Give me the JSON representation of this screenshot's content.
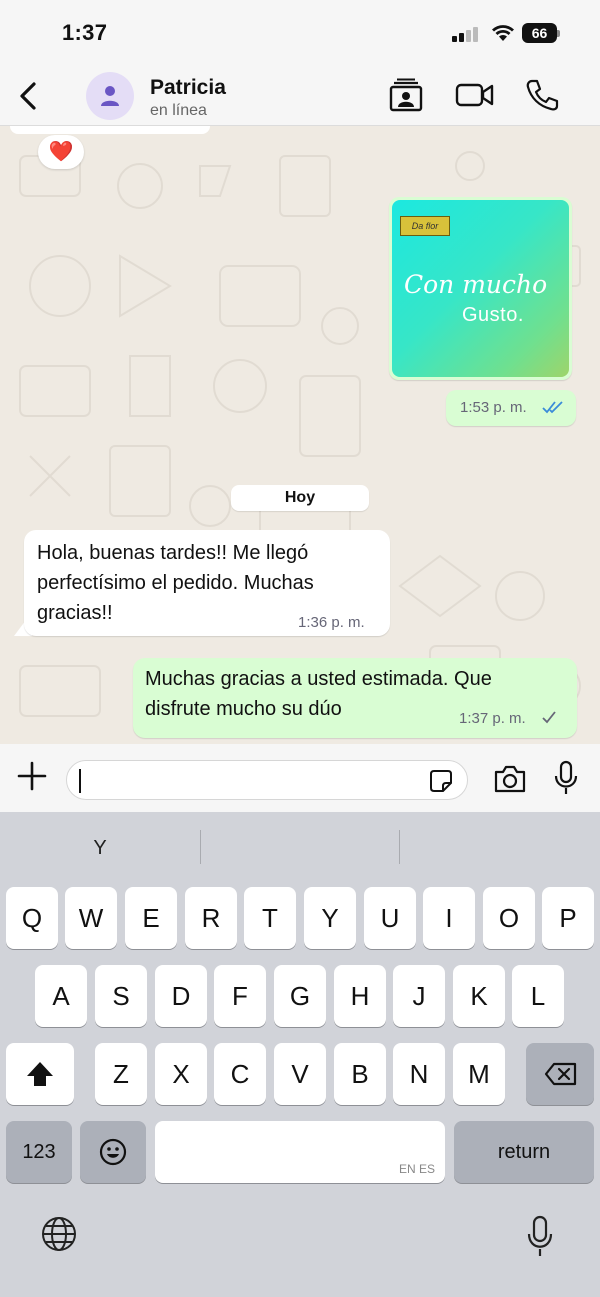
{
  "status_bar": {
    "time": "1:37",
    "battery": "66"
  },
  "header": {
    "contact_name": "Patricia",
    "contact_status": "en línea"
  },
  "chat": {
    "reaction": "❤️",
    "image_message": {
      "brand_text": "Da flor",
      "script_text": "Con mucho",
      "caption_text": "Gusto.",
      "time": "1:53 p. m."
    },
    "day_separator": "Hoy",
    "incoming": {
      "lines": [
        "Hola, buenas tardes!! Me llegó",
        "perfectísimo el pedido. Muchas",
        "gracias!!"
      ],
      "time": "1:36 p. m."
    },
    "outgoing": {
      "lines": [
        "Muchas gracias a usted estimada. Que",
        "disfrute mucho su dúo"
      ],
      "time": "1:37 p. m."
    }
  },
  "input": {
    "value": ""
  },
  "keyboard": {
    "suggestions": [
      "Y",
      "",
      ""
    ],
    "row1": [
      "Q",
      "W",
      "E",
      "R",
      "T",
      "Y",
      "U",
      "I",
      "O",
      "P"
    ],
    "row2": [
      "A",
      "S",
      "D",
      "F",
      "G",
      "H",
      "J",
      "K",
      "L"
    ],
    "row3": [
      "Z",
      "X",
      "C",
      "V",
      "B",
      "N",
      "M"
    ],
    "numbers_key": "123",
    "return_key": "return",
    "space_languages": "EN ES"
  },
  "colors": {
    "outgoing_bubble": "#d9fdd3",
    "chat_background": "#efeae2",
    "read_ticks": "#3a8bd9"
  }
}
